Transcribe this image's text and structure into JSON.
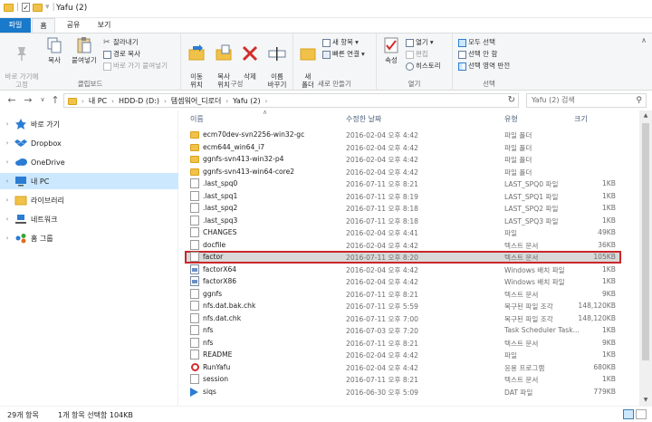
{
  "window": {
    "title": "Yafu (2)"
  },
  "ribbon_tabs": [
    "파일",
    "홈",
    "공유",
    "보기"
  ],
  "ribbon": {
    "clipboard": {
      "pin": "바로 가기에\n고정",
      "copy": "복사",
      "paste": "붙여넣기",
      "cut": "잘라내기",
      "copy_path": "경로 복사",
      "paste_shortcut": "바로 가기 붙여넣기",
      "label": "클립보드"
    },
    "organize": {
      "move": "이동\n위치",
      "copy_to": "복사\n위치",
      "delete": "삭제",
      "rename": "이름\n바꾸기",
      "label": "구성"
    },
    "new": {
      "new_folder": "새\n폴더",
      "new_item": "새 항목",
      "easy_access": "빠른 연결",
      "label": "새로 만들기"
    },
    "open": {
      "properties": "속성",
      "open": "열기",
      "edit": "편집",
      "history": "히스토리",
      "label": "열기"
    },
    "select": {
      "select_all": "모두 선택",
      "select_none": "선택 안 함",
      "invert": "선택 영역 반전",
      "label": "선택"
    }
  },
  "address": {
    "crumbs": [
      "내 PC",
      "HDD-D (D:)",
      "템셈워어_디로더",
      "Yafu (2)"
    ],
    "search_placeholder": "Yafu (2) 검색"
  },
  "nav": [
    {
      "label": "바로 가기",
      "icon": "star-icon"
    },
    {
      "label": "Dropbox",
      "icon": "dropbox-icon"
    },
    {
      "label": "OneDrive",
      "icon": "cloud-icon"
    },
    {
      "label": "내 PC",
      "icon": "computer-icon"
    },
    {
      "label": "라이브러리",
      "icon": "library-icon"
    },
    {
      "label": "네트워크",
      "icon": "network-icon"
    },
    {
      "label": "홈 그룹",
      "icon": "homegroup-icon"
    }
  ],
  "columns": {
    "name": "이름",
    "date": "수정한 날짜",
    "type": "유형",
    "size": "크기"
  },
  "files": [
    {
      "name": "ecm70dev-svn2256-win32-gc",
      "date": "2016-02-04 오후 4:42",
      "type": "파일 폴더",
      "size": "",
      "icon": "folder"
    },
    {
      "name": "ecm644_win64_i7",
      "date": "2016-02-04 오후 4:42",
      "type": "파일 폴더",
      "size": "",
      "icon": "folder"
    },
    {
      "name": "ggnfs-svn413-win32-p4",
      "date": "2016-02-04 오후 4:42",
      "type": "파일 폴더",
      "size": "",
      "icon": "folder"
    },
    {
      "name": "ggnfs-svn413-win64-core2",
      "date": "2016-02-04 오후 4:42",
      "type": "파일 폴더",
      "size": "",
      "icon": "folder"
    },
    {
      "name": ".last_spq0",
      "date": "2016-07-11 오후 8:21",
      "type": "LAST_SPQ0 파일",
      "size": "1KB",
      "icon": "doc"
    },
    {
      "name": ".last_spq1",
      "date": "2016-07-11 오후 8:19",
      "type": "LAST_SPQ1 파일",
      "size": "1KB",
      "icon": "doc"
    },
    {
      "name": ".last_spq2",
      "date": "2016-07-11 오후 8:18",
      "type": "LAST_SPQ2 파일",
      "size": "1KB",
      "icon": "doc"
    },
    {
      "name": ".last_spq3",
      "date": "2016-07-11 오후 8:18",
      "type": "LAST_SPQ3 파일",
      "size": "1KB",
      "icon": "doc"
    },
    {
      "name": "CHANGES",
      "date": "2016-02-04 오후 4:41",
      "type": "파일",
      "size": "49KB",
      "icon": "doc"
    },
    {
      "name": "docfile",
      "date": "2016-02-04 오후 4:42",
      "type": "텍스트 문서",
      "size": "36KB",
      "icon": "doc"
    },
    {
      "name": "factor",
      "date": "2016-07-11 오후 8:20",
      "type": "텍스트 문서",
      "size": "105KB",
      "icon": "doc",
      "selected": true
    },
    {
      "name": "factorX64",
      "date": "2016-02-04 오후 4:42",
      "type": "Windows 배치 파일",
      "size": "1KB",
      "icon": "bat"
    },
    {
      "name": "factorX86",
      "date": "2016-02-04 오후 4:42",
      "type": "Windows 배치 파일",
      "size": "1KB",
      "icon": "bat"
    },
    {
      "name": "ggnfs",
      "date": "2016-07-11 오후 8:21",
      "type": "텍스트 문서",
      "size": "9KB",
      "icon": "doc"
    },
    {
      "name": "nfs.dat.bak.chk",
      "date": "2016-07-11 오후 5:59",
      "type": "복구된 파일 조각",
      "size": "148,120KB",
      "icon": "doc"
    },
    {
      "name": "nfs.dat.chk",
      "date": "2016-07-11 오후 7:00",
      "type": "복구된 파일 조각",
      "size": "148,120KB",
      "icon": "doc"
    },
    {
      "name": "nfs",
      "date": "2016-07-03 오후 7:20",
      "type": "Task Scheduler Task...",
      "size": "1KB",
      "icon": "doc"
    },
    {
      "name": "nfs",
      "date": "2016-07-11 오후 8:21",
      "type": "텍스트 문서",
      "size": "9KB",
      "icon": "doc"
    },
    {
      "name": "README",
      "date": "2016-02-04 오후 4:42",
      "type": "파일",
      "size": "1KB",
      "icon": "doc"
    },
    {
      "name": "RunYafu",
      "date": "2016-02-04 오후 4:42",
      "type": "응용 프로그램",
      "size": "680KB",
      "icon": "exe"
    },
    {
      "name": "session",
      "date": "2016-07-11 오후 8:21",
      "type": "텍스트 문서",
      "size": "1KB",
      "icon": "doc"
    },
    {
      "name": "siqs",
      "date": "2016-06-30 오후 5:09",
      "type": "DAT 파일",
      "size": "779KB",
      "icon": "dat"
    }
  ],
  "status": {
    "count": "29개 항목",
    "selection": "1개 항목 선택함 104KB"
  },
  "colors": {
    "file_tab": "#1979ca",
    "selection_border": "#c8282c",
    "nav_selected": "#cce8ff"
  }
}
